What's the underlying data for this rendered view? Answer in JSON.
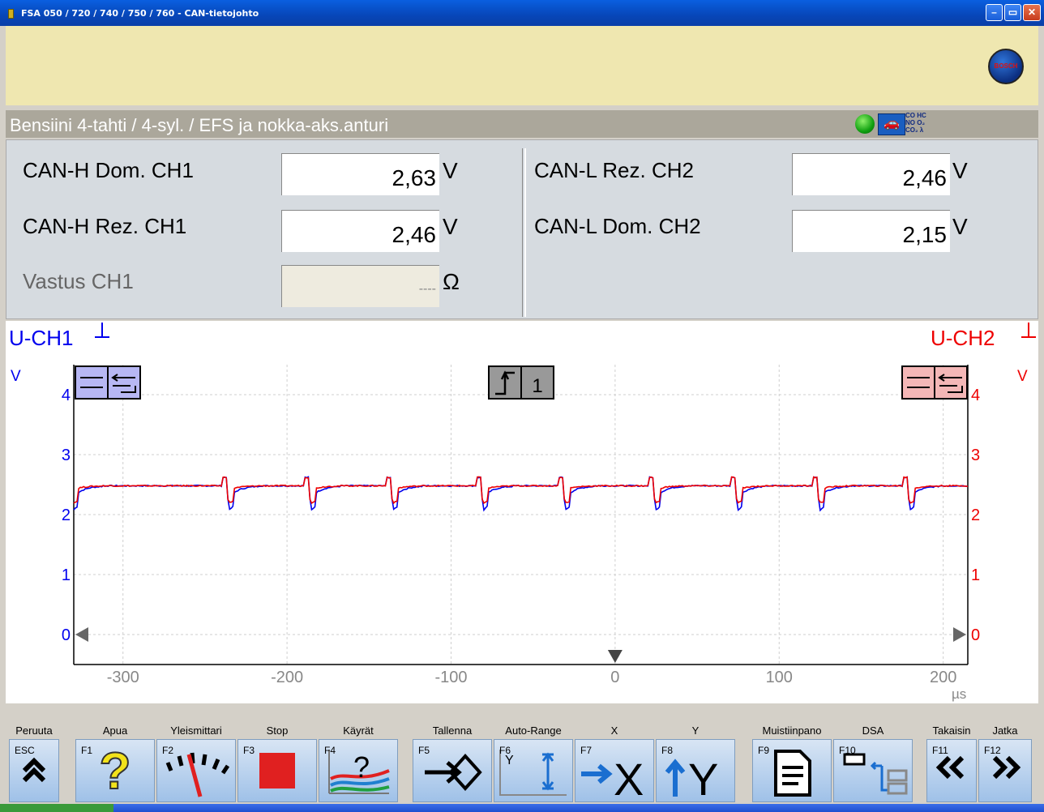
{
  "window": {
    "title": "FSA 050 / 720 / 740 / 750 / 760 - CAN-tietojohto",
    "minimize": "–",
    "restore": "▭",
    "close": "✕"
  },
  "brand": {
    "logo_text": "BOSCH"
  },
  "vehicle": {
    "description": "Bensiini 4-tahti /  4-syl. / EFS ja nokka-aks.anturi",
    "gas_labels": [
      "CO HC",
      "NO O₂",
      "CO₂ λ"
    ]
  },
  "measurements": [
    {
      "label": "CAN-H Dom. CH1",
      "value": "2,63",
      "unit": "V"
    },
    {
      "label": "CAN-H Rez. CH1",
      "value": "2,46",
      "unit": "V"
    },
    {
      "label": "Vastus CH1",
      "value": "----",
      "unit": "Ω"
    },
    {
      "label": "CAN-L Rez. CH2",
      "value": "2,46",
      "unit": "V"
    },
    {
      "label": "CAN-L Dom. CH2",
      "value": "2,15",
      "unit": "V"
    }
  ],
  "chart_data": {
    "type": "line",
    "channel_labels": [
      "U-CH1",
      "U-CH2"
    ],
    "ylabel": "V",
    "xlabel": "µs",
    "xlim": [
      -330,
      215
    ],
    "ylim": [
      -0.5,
      4.5
    ],
    "x_ticks": [
      -300,
      -200,
      -100,
      0,
      100,
      200
    ],
    "y_ticks": [
      0,
      1,
      2,
      3,
      4
    ],
    "grid": true,
    "trigger_label": "1",
    "recessive_level": 2.48,
    "series": [
      {
        "name": "U-CH1",
        "color": "#0000ee",
        "dominant_start_x": [
          -330,
          -235,
          -185,
          -135,
          -80,
          -30,
          25,
          75,
          125,
          180
        ]
      },
      {
        "name": "U-CH2",
        "color": "#ee0000",
        "dominant_start_x": [
          -330,
          -235,
          -185,
          -135,
          -80,
          -30,
          25,
          75,
          125,
          180
        ]
      }
    ]
  },
  "fkeys": [
    {
      "label": "Peruuta",
      "code": "ESC",
      "icon": "double-chevron-up-icon"
    },
    {
      "label": "Apua",
      "code": "F1",
      "icon": "question-icon"
    },
    {
      "label": "Yleismittari",
      "code": "F2",
      "icon": "gauge-icon"
    },
    {
      "label": "Stop",
      "code": "F3",
      "icon": "stop-icon"
    },
    {
      "label": "Käyrät",
      "code": "F4",
      "icon": "curves-icon"
    },
    {
      "label": "Tallenna",
      "code": "F5",
      "icon": "save-arrow-icon"
    },
    {
      "label": "Auto-Range",
      "code": "F6",
      "icon": "auto-range-icon"
    },
    {
      "label": "X",
      "code": "F7",
      "icon": "arrow-right-x-icon"
    },
    {
      "label": "Y",
      "code": "F8",
      "icon": "arrow-up-y-icon"
    },
    {
      "label": "Muistiinpano",
      "code": "F9",
      "icon": "note-icon"
    },
    {
      "label": "DSA",
      "code": "F10",
      "icon": "dsa-icon"
    },
    {
      "label": "Takaisin",
      "code": "F11",
      "icon": "double-chevron-left-icon"
    },
    {
      "label": "Jatka",
      "code": "F12",
      "icon": "double-chevron-right-icon"
    }
  ]
}
